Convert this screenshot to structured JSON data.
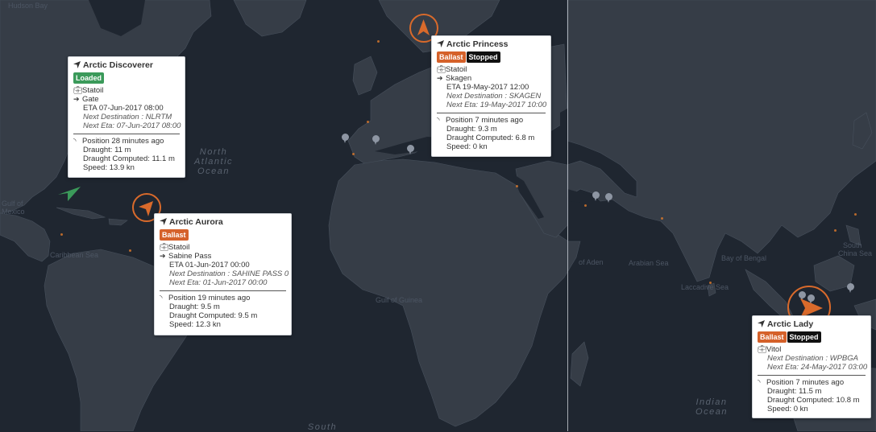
{
  "map": {
    "place_labels": {
      "hudson_bay": "Hudson Bay",
      "gulf_of_mexico_1": "Gulf of",
      "gulf_of_mexico_2": "Mexico",
      "caribbean_sea": "Caribbean Sea",
      "gulf_of_guinea": "Gulf of Guinea",
      "gulf_of_aden": "of Aden",
      "arabian_sea": "Arabian Sea",
      "bay_of_bengal": "Bay of Bengal",
      "laccadive_sea": "Laccadive Sea",
      "south_china_sea_1": "South",
      "south_china_sea_2": "China Sea"
    },
    "ocean_labels": {
      "north_atlantic_1": "North",
      "north_atlantic_2": "Atlantic",
      "north_atlantic_3": "Ocean",
      "indian_ocean_1": "Indian",
      "indian_ocean_2": "Ocean",
      "south": "South"
    }
  },
  "vessels": [
    {
      "name": "Arctic Discoverer",
      "badges": [
        "Loaded"
      ],
      "charterer": "Statoil",
      "destination": "Gate",
      "eta": "ETA 07-Jun-2017 08:00",
      "next_destination": "Next Destination : NLRTM",
      "next_eta": "Next Eta: 07-Jun-2017 08:00",
      "position": "Position 28 minutes ago",
      "draught": "Draught: 11 m",
      "draught_computed": "Draught Computed: 11.1 m",
      "speed": "Speed: 13.9 kn"
    },
    {
      "name": "Arctic Princess",
      "badges": [
        "Ballast",
        "Stopped"
      ],
      "charterer": "Statoil",
      "destination": "Skagen",
      "eta": "ETA 19-May-2017 12:00",
      "next_destination": "Next Destination : SKAGEN",
      "next_eta": "Next Eta: 19-May-2017 10:00",
      "position": "Position 7 minutes ago",
      "draught": "Draught: 9.3 m",
      "draught_computed": "Draught Computed: 6.8 m",
      "speed": "Speed: 0 kn"
    },
    {
      "name": "Arctic Aurora",
      "badges": [
        "Ballast"
      ],
      "charterer": "Statoil",
      "destination": "Sabine Pass",
      "eta": "ETA 01-Jun-2017 00:00",
      "next_destination": "Next Destination : SAHINE PASS 0",
      "next_eta": "Next Eta: 01-Jun-2017 00:00",
      "position": "Position 19 minutes ago",
      "draught": "Draught: 9.5 m",
      "draught_computed": "Draught Computed: 9.5 m",
      "speed": "Speed: 12.3 kn"
    },
    {
      "name": "Arctic Lady",
      "badges": [
        "Ballast",
        "Stopped"
      ],
      "charterer": "Vitol",
      "next_destination": "Next Destination : WPBGA",
      "next_eta": "Next Eta: 24-May-2017 03:00",
      "position": "Position 7 minutes ago",
      "draught": "Draught: 11.5 m",
      "draught_computed": "Draught Computed: 10.8 m",
      "speed": "Speed: 0 kn"
    }
  ],
  "colors": {
    "water": "#1f2630",
    "land": "#363d47",
    "accent": "#d96a2b",
    "loaded": "#3b9a5a",
    "ballast": "#d5612a",
    "stopped": "#111111"
  },
  "icons": {
    "vessel": "navigation-arrow-icon",
    "charterer": "briefcase-icon",
    "destination": "arrow-right-icon",
    "position": "signal-feed-icon",
    "port": "map-pin-icon"
  }
}
